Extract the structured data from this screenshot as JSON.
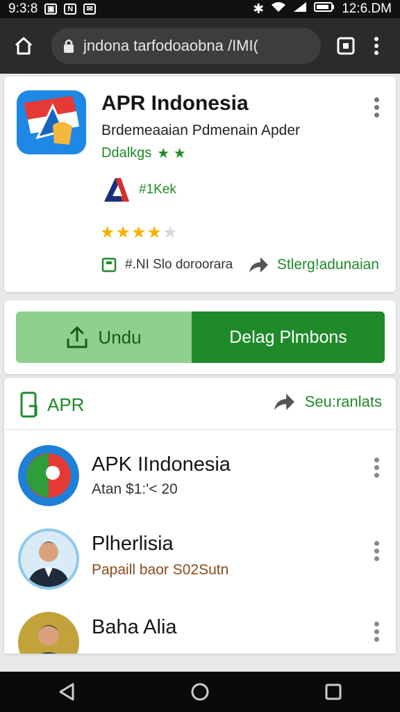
{
  "status_bar": {
    "time_left": "9:3:8",
    "time_right": "12:6.DM",
    "notif_icons": [
      "photo-icon",
      "n-icon",
      "message-icon"
    ],
    "right_icons": [
      "bluetooth-icon",
      "wifi-icon",
      "signal-icon",
      "battery-icon"
    ]
  },
  "browser": {
    "url": "jndona tarfodoaobna /IMI("
  },
  "app": {
    "title": "APR Indonesia",
    "subtitle": "Brdemeaaian Pdmenain Apder",
    "developer": "Ddalkgs",
    "publisher_text": "#1Kek",
    "rating": 4,
    "meta_left": "#.NI Slo doroorara",
    "meta_right": "Stlerg!adunaian"
  },
  "buttons": {
    "download_label": "Undu",
    "primary_label": "Delag Plmbons"
  },
  "list": {
    "header_left": "APR",
    "header_right": "Seu:ranlats",
    "items": [
      {
        "title": "APK IIndonesia",
        "subtitle": "Atan $1:'< 20"
      },
      {
        "title": "Plherlisia",
        "subtitle": "Papaill baor S02Sutn"
      },
      {
        "title": "Baha Alia",
        "subtitle": ""
      }
    ]
  },
  "colors": {
    "accent_green": "#1e8a2a",
    "light_green": "#8fd18c",
    "star_yellow": "#f4b400",
    "topbar": "#2b2b2b"
  }
}
